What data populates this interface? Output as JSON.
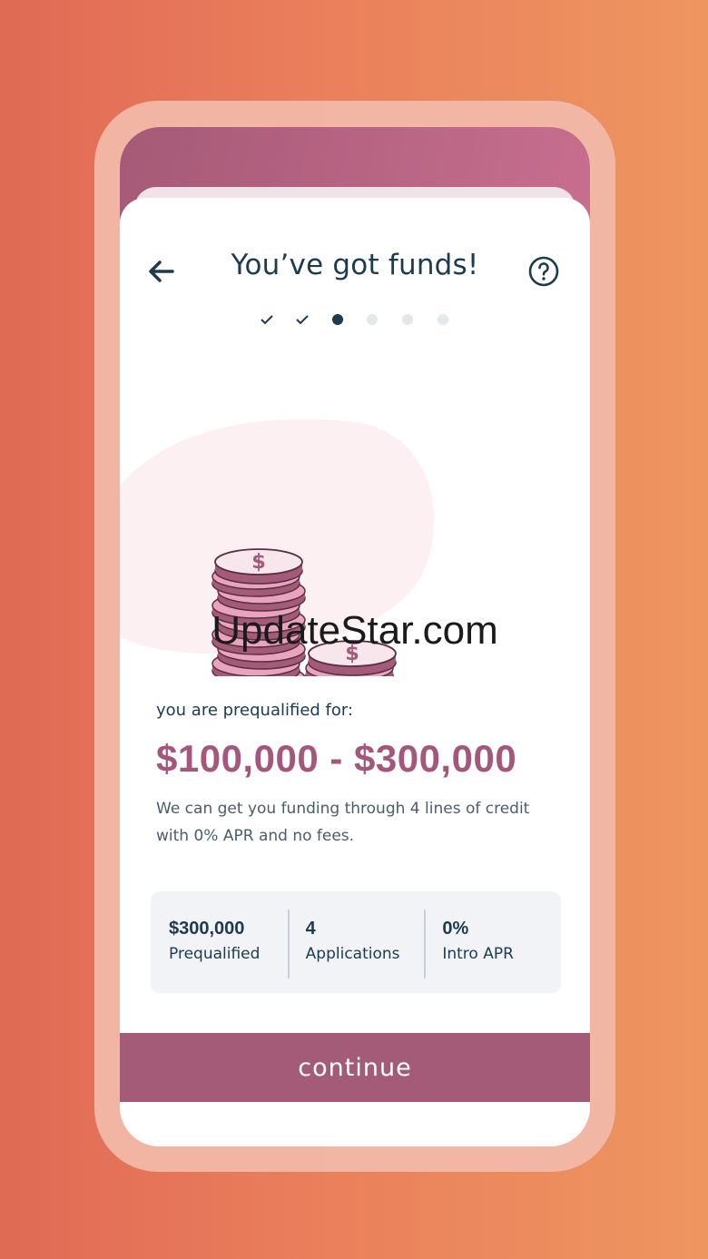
{
  "header": {
    "title": "You’ve got funds!",
    "back_icon": "arrow-left-icon",
    "help_icon": "question-circle-icon"
  },
  "progress": {
    "steps_total": 6,
    "current_step": 3,
    "completed_steps": 2
  },
  "watermark": "UpdateStar.com",
  "offer": {
    "label": "you are prequalified for:",
    "amount_range": "$100,000 - $300,000",
    "description": "We can get you funding through 4 lines of credit with 0% APR and no fees."
  },
  "stats": [
    {
      "value": "$300,000",
      "label": "Prequalified"
    },
    {
      "value": "4",
      "label": "Applications"
    },
    {
      "value": "0%",
      "label": "Intro APR"
    }
  ],
  "actions": {
    "continue_label": "continue"
  },
  "colors": {
    "brand": "#a35b77",
    "amount": "#a4577a",
    "text_dark": "#1d3a4f",
    "coin_dark": "#a35b77",
    "coin_light": "#e9a4bd"
  }
}
